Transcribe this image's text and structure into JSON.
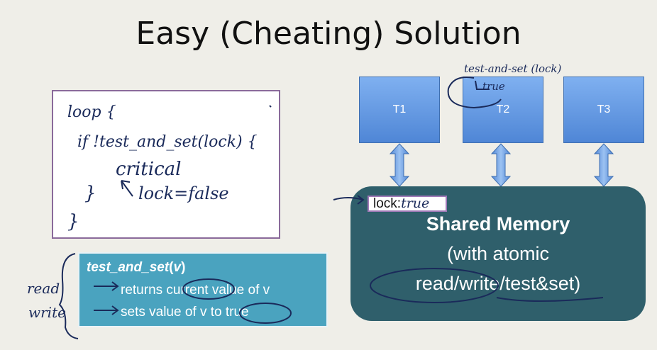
{
  "slide": {
    "title": "Easy (Cheating) Solution"
  },
  "code_box": {
    "handwritten_lines": [
      "loop {",
      "if !test_and_set(lock) {",
      "critical",
      "lock=false",
      "}",
      "}"
    ]
  },
  "info_box": {
    "title_func": "test_and_set",
    "title_open": "(",
    "title_var": "v",
    "title_close": ")",
    "line1": "returns current value of v",
    "line2": "sets value of v to true"
  },
  "annotations": {
    "read": "read",
    "write": "write",
    "tas_note": "test-and-set (lock)",
    "tas_result": "true",
    "lock_value": "true"
  },
  "threads": [
    {
      "label": "T1"
    },
    {
      "label": "T2"
    },
    {
      "label": "T3"
    }
  ],
  "shared_memory": {
    "lock_label": "lock:",
    "title": "Shared Memory",
    "subtitle1": "(with atomic",
    "subtitle2": "read/write/test&set)"
  },
  "colors": {
    "thread_fill": "#5b8fdc",
    "memory_fill": "#2f5f6b",
    "info_fill": "#4aa3bf",
    "ink": "#1a2a5a"
  }
}
